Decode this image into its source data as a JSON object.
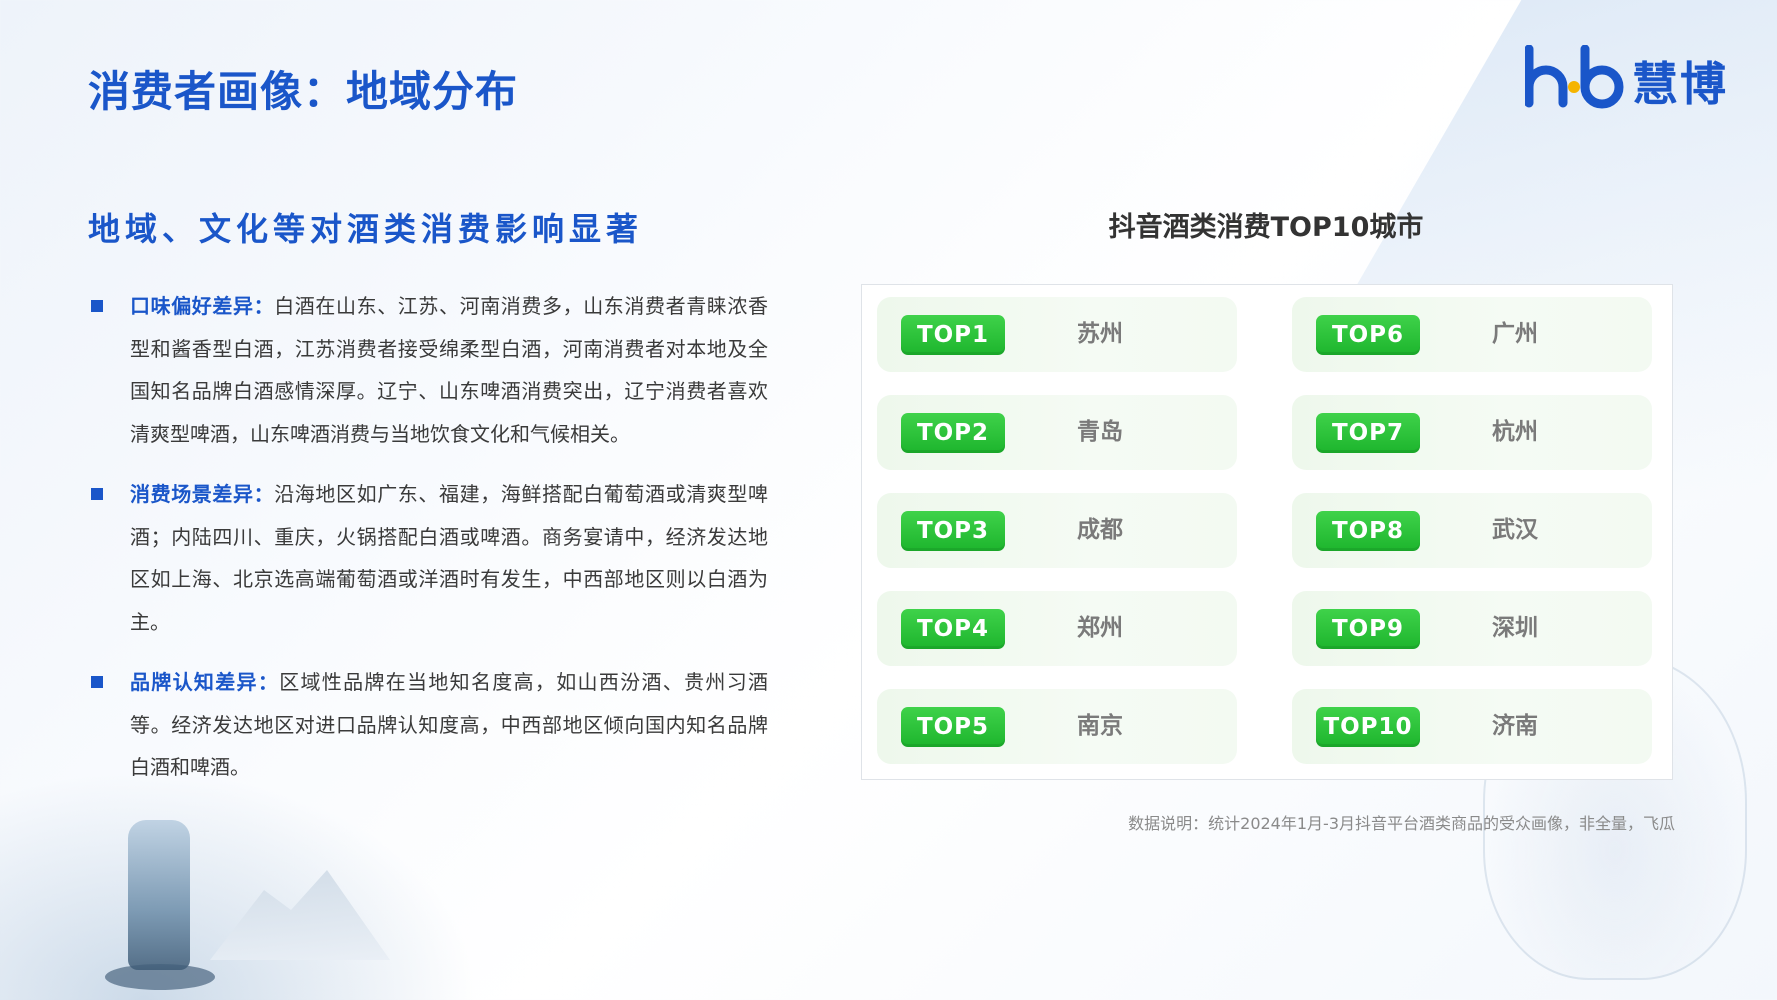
{
  "header": {
    "title": "消费者画像：地域分布",
    "logo_text": "慧博"
  },
  "left": {
    "subtitle": "地域、文化等对酒类消费影响显著",
    "bullets": [
      {
        "head": "口味偏好差异：",
        "body": "白酒在山东、江苏、河南消费多，山东消费者青睐浓香型和酱香型白酒，江苏消费者接受绵柔型白酒，河南消费者对本地及全国知名品牌白酒感情深厚。辽宁、山东啤酒消费突出，辽宁消费者喜欢清爽型啤酒，山东啤酒消费与当地饮食文化和气候相关。"
      },
      {
        "head": "消费场景差异：",
        "body": "沿海地区如广东、福建，海鲜搭配白葡萄酒或清爽型啤酒；内陆四川、重庆，火锅搭配白酒或啤酒。商务宴请中，经济发达地区如上海、北京选高端葡萄酒或洋酒时有发生，中西部地区则以白酒为主。"
      },
      {
        "head": "品牌认知差异：",
        "body": "区域性品牌在当地知名度高，如山西汾酒、贵州习酒等。经济发达地区对进口品牌认知度高，中西部地区倾向国内知名品牌白酒和啤酒。"
      }
    ]
  },
  "ranking": {
    "title": "抖音酒类消费TOP10城市",
    "left_column": [
      {
        "rank": "TOP1",
        "city": "苏州"
      },
      {
        "rank": "TOP2",
        "city": "青岛"
      },
      {
        "rank": "TOP3",
        "city": "成都"
      },
      {
        "rank": "TOP4",
        "city": "郑州"
      },
      {
        "rank": "TOP5",
        "city": "南京"
      }
    ],
    "right_column": [
      {
        "rank": "TOP6",
        "city": "广州"
      },
      {
        "rank": "TOP7",
        "city": "杭州"
      },
      {
        "rank": "TOP8",
        "city": "武汉"
      },
      {
        "rank": "TOP9",
        "city": "深圳"
      },
      {
        "rank": "TOP10",
        "city": "济南"
      }
    ],
    "note": "数据说明：统计2024年1月-3月抖音平台酒类商品的受众画像，非全量，飞瓜"
  },
  "colors": {
    "brand_blue": "#1a56c9",
    "badge_green": "#1db52d",
    "logo_dot": "#f5b400"
  },
  "icons": [
    "hb-logo-icon",
    "bullet-square-icon"
  ]
}
